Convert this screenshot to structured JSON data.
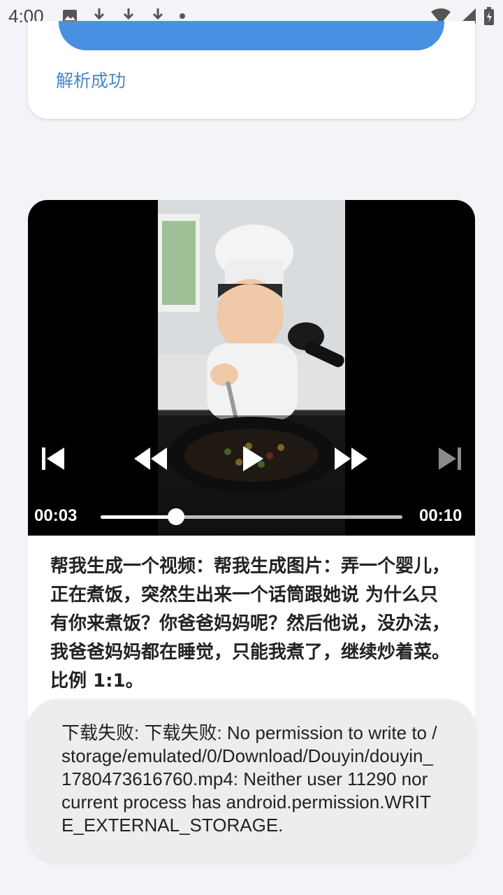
{
  "status_bar": {
    "time": "4:00",
    "icons": [
      "image-icon",
      "download-icon",
      "download-icon",
      "download-icon",
      "dot-icon"
    ],
    "right_icons": [
      "wifi-icon",
      "signal-icon",
      "battery-icon"
    ]
  },
  "top_card": {
    "status_text": "解析成功"
  },
  "player": {
    "current_time": "00:03",
    "duration": "00:10",
    "progress_fraction": 0.25
  },
  "video": {
    "description": "帮我生成一个视频：帮我生成图片：弄一个婴儿，正在煮饭，突然生出来一个话筒跟她说 为什么只有你来煮饭？你爸爸妈妈呢？然后他说，没办法，我爸爸妈妈都在睡觉，只能我煮了，继续炒着菜。比例 1:1。"
  },
  "toast": {
    "message": "下载失败: 下载失败: No permission to write to /storage/emulated/0/Download/Douyin/douyin_1780473616760.mp4: Neither user 11290 nor current process has android.permission.WRITE_EXTERNAL_STORAGE."
  }
}
